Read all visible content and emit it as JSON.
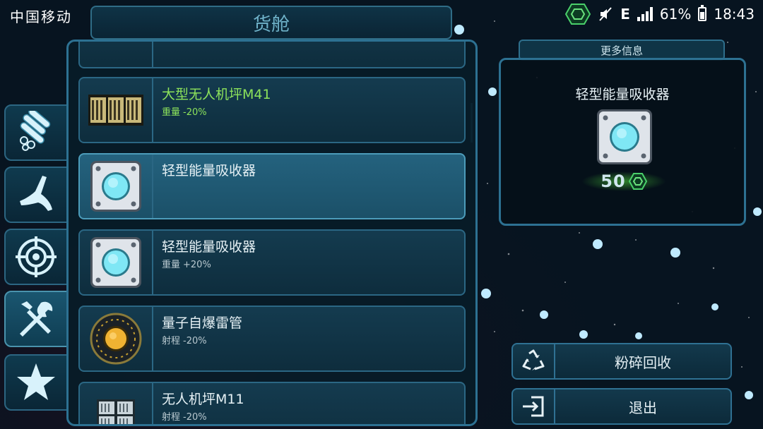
{
  "status_bar": {
    "carrier": "中国移动",
    "network": "E",
    "battery": "61%",
    "time": "18:43"
  },
  "title": "货舱",
  "category_tabs": [
    {
      "icon": "pipes-icon"
    },
    {
      "icon": "claw-icon"
    },
    {
      "icon": "target-icon"
    },
    {
      "icon": "tools-icon"
    },
    {
      "icon": "star-icon"
    }
  ],
  "inventory": {
    "items": [
      {
        "name": "大型无人机坪M41",
        "stat_label": "重量",
        "stat_value": "-20%",
        "icon": "drone-pad-large-icon",
        "highlight": "green"
      },
      {
        "name": "轻型能量吸收器",
        "stat_label": "",
        "stat_value": "",
        "icon": "energy-absorber-icon",
        "selected": true
      },
      {
        "name": "轻型能量吸收器",
        "stat_label": "重量",
        "stat_value": "+20%",
        "icon": "energy-absorber-icon"
      },
      {
        "name": "量子自爆雷管",
        "stat_label": "射程",
        "stat_value": "-20%",
        "icon": "quantum-detonator-icon"
      },
      {
        "name": "无人机坪M11",
        "stat_label": "射程",
        "stat_value": "-20%",
        "icon": "drone-pad-icon"
      }
    ]
  },
  "info_panel": {
    "header": "更多信息",
    "item_name": "轻型能量吸收器",
    "price": "50",
    "currency_icon": "crystal-hex-icon"
  },
  "actions": {
    "recycle_label": "粉碎回收",
    "exit_label": "退出"
  },
  "colors": {
    "accent_green": "#8de35b",
    "panel_border": "#2d7192",
    "selected_bg": "#24627e"
  }
}
